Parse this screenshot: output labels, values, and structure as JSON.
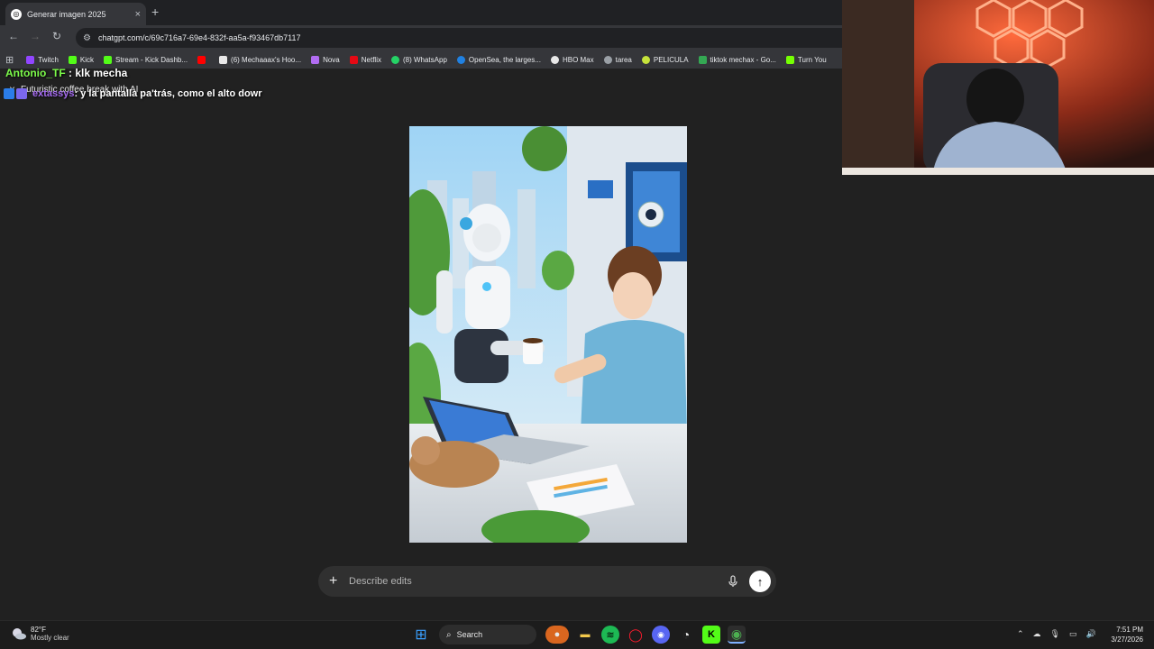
{
  "browser": {
    "tab_title": "Generar imagen 2025",
    "tab_close": "×",
    "new_tab": "+",
    "url": "chatgpt.com/c/69c716a7-69e4-832f-aa5a-f93467db7117",
    "bookmarks": [
      {
        "label": "Twitch",
        "color": "#9146ff"
      },
      {
        "label": "Kick",
        "color": "#53fc18"
      },
      {
        "label": "Stream - Kick Dashb...",
        "color": "#53fc18"
      },
      {
        "label": "",
        "color": "#ff0000"
      },
      {
        "label": "(6) Mechaaax's Hoo...",
        "color": "#e8e8e8"
      },
      {
        "label": "Nova",
        "color": "#b16cf2"
      },
      {
        "label": "Netflix",
        "color": "#e50914"
      },
      {
        "label": "(8) WhatsApp",
        "color": "#25d366"
      },
      {
        "label": "OpenSea, the larges...",
        "color": "#2081e2"
      },
      {
        "label": "HBO Max",
        "color": "#e8e8e8"
      },
      {
        "label": "tarea",
        "color": "#9aa0a6"
      },
      {
        "label": "PELICULA",
        "color": "#c6e33b"
      },
      {
        "label": "tiktok mechax - Go...",
        "color": "#34a853"
      },
      {
        "label": "Turn You",
        "color": "#76ff03"
      }
    ]
  },
  "stream_overlay": {
    "chat1_user": "Antonio_TF",
    "chat1_text": " : klk mecha",
    "chat2_user": "extassys",
    "chat2_text": " : y la pantalla pa'trás, como el alto dowr"
  },
  "conversation": {
    "title": "Futuristic coffee break with AI",
    "close": "×"
  },
  "composer": {
    "placeholder": "Describe edits",
    "plus": "+",
    "send": "↑"
  },
  "taskbar": {
    "temperature": "82°F",
    "condition": "Mostly clear",
    "search_label": "Search",
    "time": "7:51 PM",
    "date": "3/27/2026"
  }
}
